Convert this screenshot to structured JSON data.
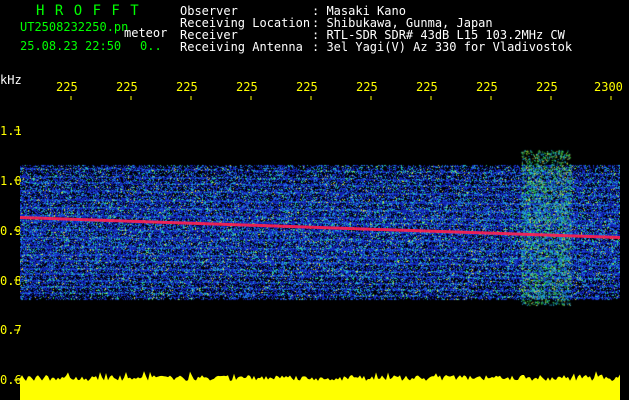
{
  "header": {
    "station": "H R O F F T",
    "file_name": "UT2508232250.pn",
    "file_suffix": "meteor",
    "datetime": "25.08.23 22:50",
    "counter": "0..",
    "info_labels": [
      "Observer",
      "Receiving Location",
      "Receiver",
      "Receiving Antenna"
    ],
    "info_values": [
      ": Masaki Kano",
      ": Shibukawa, Gunma, Japan",
      ": RTL-SDR SDR# 43dB L15 103.2MHz CW",
      ": 3el Yagi(V) Az 330 for Vladivostok"
    ]
  },
  "chart_data": {
    "type": "heatmap",
    "ylabel": "kHz",
    "x_tick_labels": [
      "225",
      "225",
      "225",
      "225",
      "225",
      "225",
      "225",
      "225",
      "225",
      "2300"
    ],
    "y_tick_labels": [
      "1.1",
      "1.0",
      "0.9",
      "0.8",
      "0.7",
      "0.6"
    ],
    "ylim": [
      0.6,
      1.15
    ],
    "signal_band_khz": [
      0.76,
      1.03
    ],
    "carrier_trace_khz": {
      "start": 0.925,
      "end": 0.885
    },
    "meteor_echo_x_fraction": 0.86,
    "colors": {
      "background": "#000000",
      "noise": "#1020c0",
      "carrier": "#ff2050",
      "echo": "#40ff40",
      "amplitude_bar": "#ffff00",
      "ticks": "#ffff00"
    }
  }
}
